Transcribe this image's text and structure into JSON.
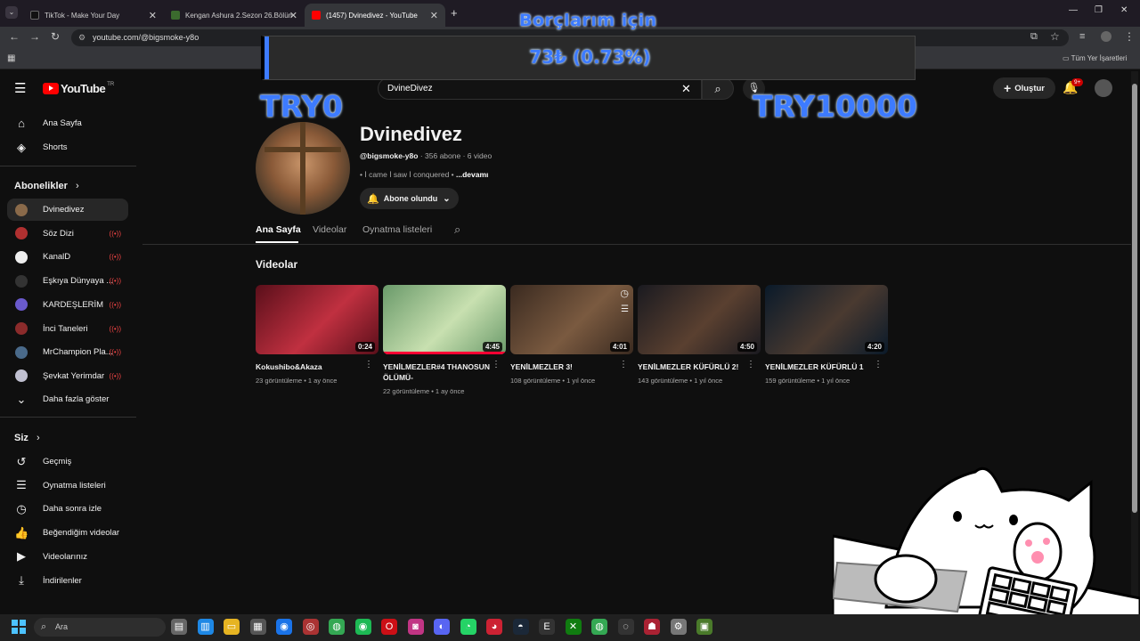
{
  "browser": {
    "tabs": [
      {
        "title": "TikTok - Make Your Day",
        "favicon_color": "#111111"
      },
      {
        "title": "Kengan Ashura 2.Sezon 26.Bölüm",
        "favicon_color": "#3b6b2e"
      },
      {
        "title": "(1457) Dvinedivez - YouTube",
        "favicon_color": "#ff0000",
        "active": true
      }
    ],
    "new_tab_glyph": "+",
    "url": "youtube.com/@bigsmoke-y8o",
    "bookmarks_label": "Tüm Yer İşaretleri"
  },
  "donation_overlay": {
    "heading": "Borçlarım için",
    "amount": "73₺ (0.73%)",
    "min_label": "TRY0",
    "max_label": "TRY10000",
    "progress_percent": 0.73
  },
  "youtube": {
    "logo_text": "YouTube",
    "region": "TR",
    "search_value": "DvineDivez",
    "create_label": "Oluştur",
    "notifications_badge": "9+",
    "sidebar": {
      "main": [
        {
          "label": "Ana Sayfa",
          "icon": "home-icon",
          "glyph": "⌂"
        },
        {
          "label": "Shorts",
          "icon": "shorts-icon",
          "glyph": "◈"
        }
      ],
      "subscriptions_heading": "Abonelikler",
      "subscriptions": [
        {
          "label": "Dvinedivez",
          "color": "#8a6a4a",
          "live": false
        },
        {
          "label": "Söz Dizi",
          "color": "#b03030",
          "live": true
        },
        {
          "label": "KanalD",
          "color": "#eeeeee",
          "live": true
        },
        {
          "label": "Eşkıya Dünyaya ...",
          "color": "#333333",
          "live": true
        },
        {
          "label": "KARDEŞLERİM",
          "color": "#6a5acd",
          "live": true
        },
        {
          "label": "İnci Taneleri",
          "color": "#8b2b2b",
          "live": true
        },
        {
          "label": "MrChampion Pla...",
          "color": "#4a6a8a",
          "live": true
        },
        {
          "label": "Şevkat Yerimdar",
          "color": "#c0c0d0",
          "live": true
        }
      ],
      "show_more": "Daha fazla göster",
      "you_heading": "Siz",
      "you_items": [
        {
          "label": "Geçmiş",
          "icon": "history-icon",
          "glyph": "↺"
        },
        {
          "label": "Oynatma listeleri",
          "icon": "playlist-icon",
          "glyph": "☰"
        },
        {
          "label": "Daha sonra izle",
          "icon": "clock-icon",
          "glyph": "◷"
        },
        {
          "label": "Beğendiğim videolar",
          "icon": "thumbs-up-icon",
          "glyph": "👍"
        },
        {
          "label": "Videolarınız",
          "icon": "your-videos-icon",
          "glyph": "▶"
        },
        {
          "label": "İndirilenler",
          "icon": "download-icon",
          "glyph": "⤓"
        }
      ]
    },
    "channel": {
      "name": "Dvinedivez",
      "handle": "@bigsmoke-y8o",
      "subscribers": "356 abone",
      "video_count": "6 video",
      "description": "İ came İ saw İ conquered",
      "more_link": "...devamı",
      "subscribed_label": "Abone olundu",
      "tabs": [
        "Ana Sayfa",
        "Videolar",
        "Oynatma listeleri"
      ],
      "section_title": "Videolar",
      "videos": [
        {
          "title": "Kokushibo&Akaza",
          "duration": "0:24",
          "views": "23 görüntüleme",
          "age": "1 ay önce",
          "color1": "#5a0f1a",
          "color2": "#c03040"
        },
        {
          "title": "YENİLMEZLER#4 THANOSUN ÖLÜMÜ-",
          "duration": "4:45",
          "views": "22 görüntüleme",
          "age": "1 ay önce",
          "color1": "#6a9a6a",
          "color2": "#c8e0b0"
        },
        {
          "title": "YENİLMEZLER 3!",
          "duration": "4:01",
          "views": "108 görüntüleme",
          "age": "1 yıl önce",
          "color1": "#3a2a20",
          "color2": "#7a5a40"
        },
        {
          "title": "YENİLMEZLER KÜFÜRLÜ 2!",
          "duration": "4:50",
          "views": "143 görüntüleme",
          "age": "1 yıl önce",
          "color1": "#1a1a20",
          "color2": "#5a4030"
        },
        {
          "title": "YENİLMEZLER KÜFÜRLÜ 1",
          "duration": "4:20",
          "views": "159 görüntüleme",
          "age": "1 yıl önce",
          "color1": "#0a1a2a",
          "color2": "#4a3a30"
        }
      ]
    }
  },
  "taskbar": {
    "search_label": "Ara",
    "apps": [
      {
        "name": "file-icon",
        "color": "#666666",
        "glyph": "▤"
      },
      {
        "name": "notes-icon",
        "color": "#1e88e5",
        "glyph": "▥"
      },
      {
        "name": "folder-icon",
        "color": "#e6b422",
        "glyph": "▭"
      },
      {
        "name": "store-icon",
        "color": "#555555",
        "glyph": "▦"
      },
      {
        "name": "edge-icon",
        "color": "#1a73e8",
        "glyph": "◉"
      },
      {
        "name": "app-icon",
        "color": "#aa3333",
        "glyph": "◎"
      },
      {
        "name": "chrome-icon",
        "color": "#34a853",
        "glyph": "◍"
      },
      {
        "name": "spotify-icon",
        "color": "#1db954",
        "glyph": "◉"
      },
      {
        "name": "opera-icon",
        "color": "#cc0f16",
        "glyph": "O"
      },
      {
        "name": "instagram-icon",
        "color": "#c13584",
        "glyph": "◙"
      },
      {
        "name": "discord-icon",
        "color": "#5865f2",
        "glyph": "◐"
      },
      {
        "name": "whatsapp-icon",
        "color": "#25d366",
        "glyph": "◔"
      },
      {
        "name": "app2-icon",
        "color": "#cc2233",
        "glyph": "◕"
      },
      {
        "name": "steam-icon",
        "color": "#1b2838",
        "glyph": "◓"
      },
      {
        "name": "epic-icon",
        "color": "#333333",
        "glyph": "E"
      },
      {
        "name": "xbox-icon",
        "color": "#107c10",
        "glyph": "✕"
      },
      {
        "name": "chrome2-icon",
        "color": "#34a853",
        "glyph": "◍"
      },
      {
        "name": "obs-icon",
        "color": "#333333",
        "glyph": "◌"
      },
      {
        "name": "game-icon",
        "color": "#aa2233",
        "glyph": "☗"
      },
      {
        "name": "settings-icon",
        "color": "#777777",
        "glyph": "⚙"
      },
      {
        "name": "minecraft-icon",
        "color": "#4a7a2a",
        "glyph": "▣"
      }
    ]
  }
}
